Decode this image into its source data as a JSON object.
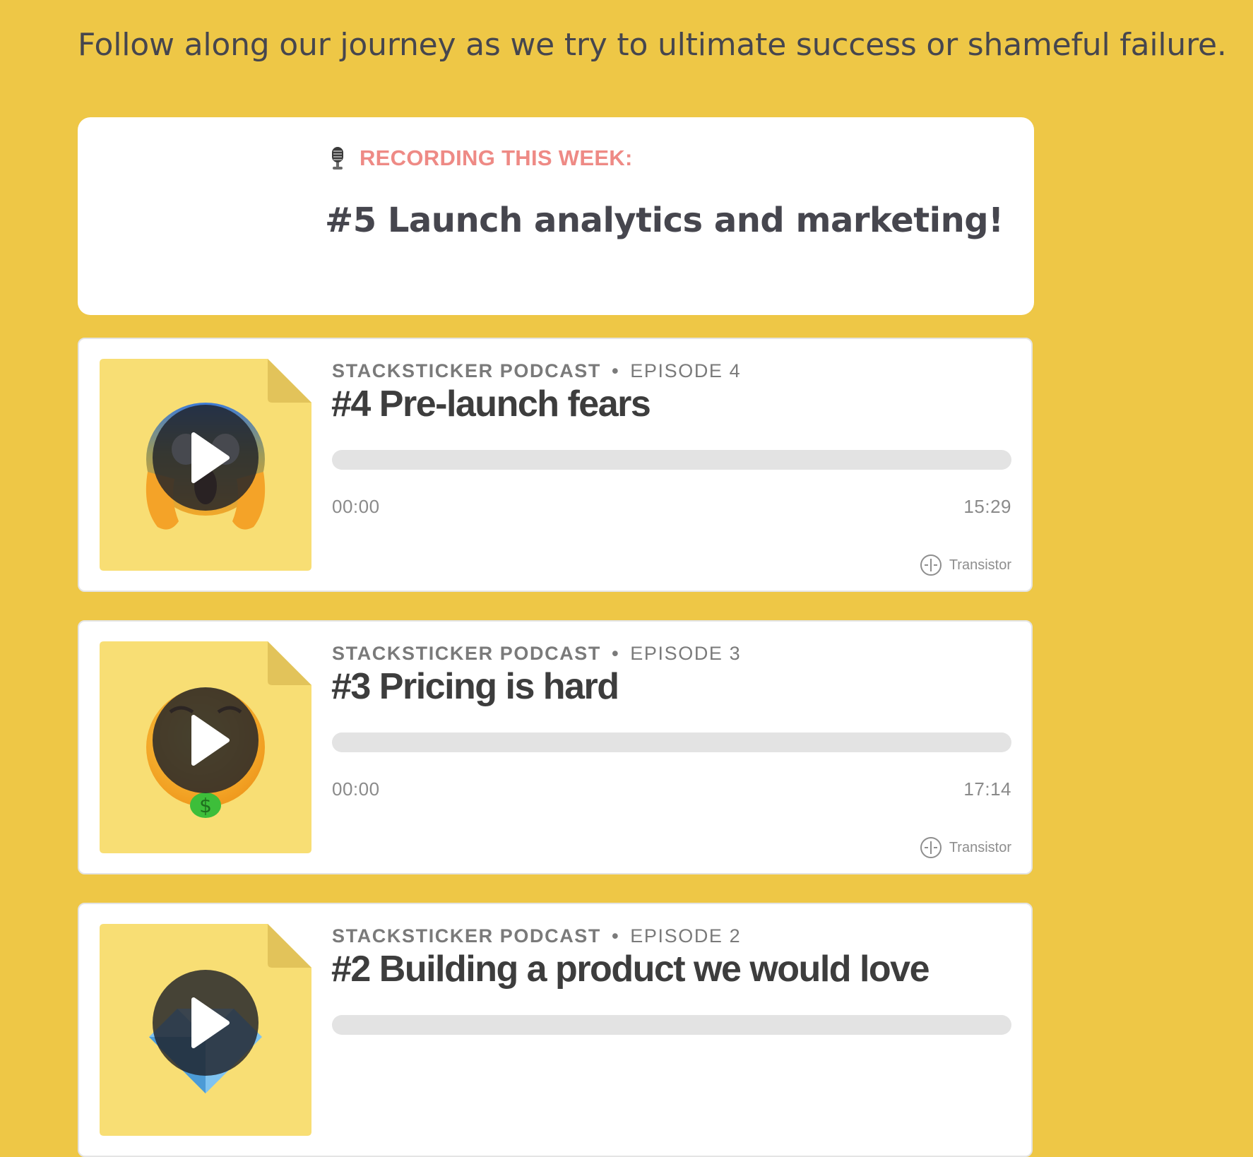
{
  "intro": {
    "text": "Follow along our journey as we try to ultimate success or shameful failure."
  },
  "recording": {
    "icon": "microphone-icon",
    "label": "RECORDING THIS WEEK:",
    "title": "#5 Launch analytics and marketing!",
    "label_color": "#EE8A85"
  },
  "colors": {
    "page_background": "#EEC746",
    "card_background": "#FFFFFF",
    "artwork_background": "#F8DE74",
    "progress_track": "#E3E3E3",
    "title_text": "#3D3D3D",
    "meta_text": "#7A7A7A"
  },
  "episodes": [
    {
      "show": "STACKSTICKER PODCAST",
      "separator": "•",
      "episode_label": "EPISODE 4",
      "title": "#4 Pre-launch fears",
      "artwork_emoji": "screaming-face-emoji",
      "time_current": "00:00",
      "time_total": "15:29",
      "progress": 0,
      "brand": "Transistor",
      "brand_icon": "transistor-logo-icon"
    },
    {
      "show": "STACKSTICKER PODCAST",
      "separator": "•",
      "episode_label": "EPISODE 3",
      "title": "#3 Pricing is hard",
      "artwork_emoji": "money-mouth-face-emoji",
      "time_current": "00:00",
      "time_total": "17:14",
      "progress": 0,
      "brand": "Transistor",
      "brand_icon": "transistor-logo-icon"
    },
    {
      "show": "STACKSTICKER PODCAST",
      "separator": "•",
      "episode_label": "EPISODE 2",
      "title": "#2 Building a product we would love",
      "artwork_emoji": "gem-stone-emoji",
      "progress": 0
    }
  ]
}
